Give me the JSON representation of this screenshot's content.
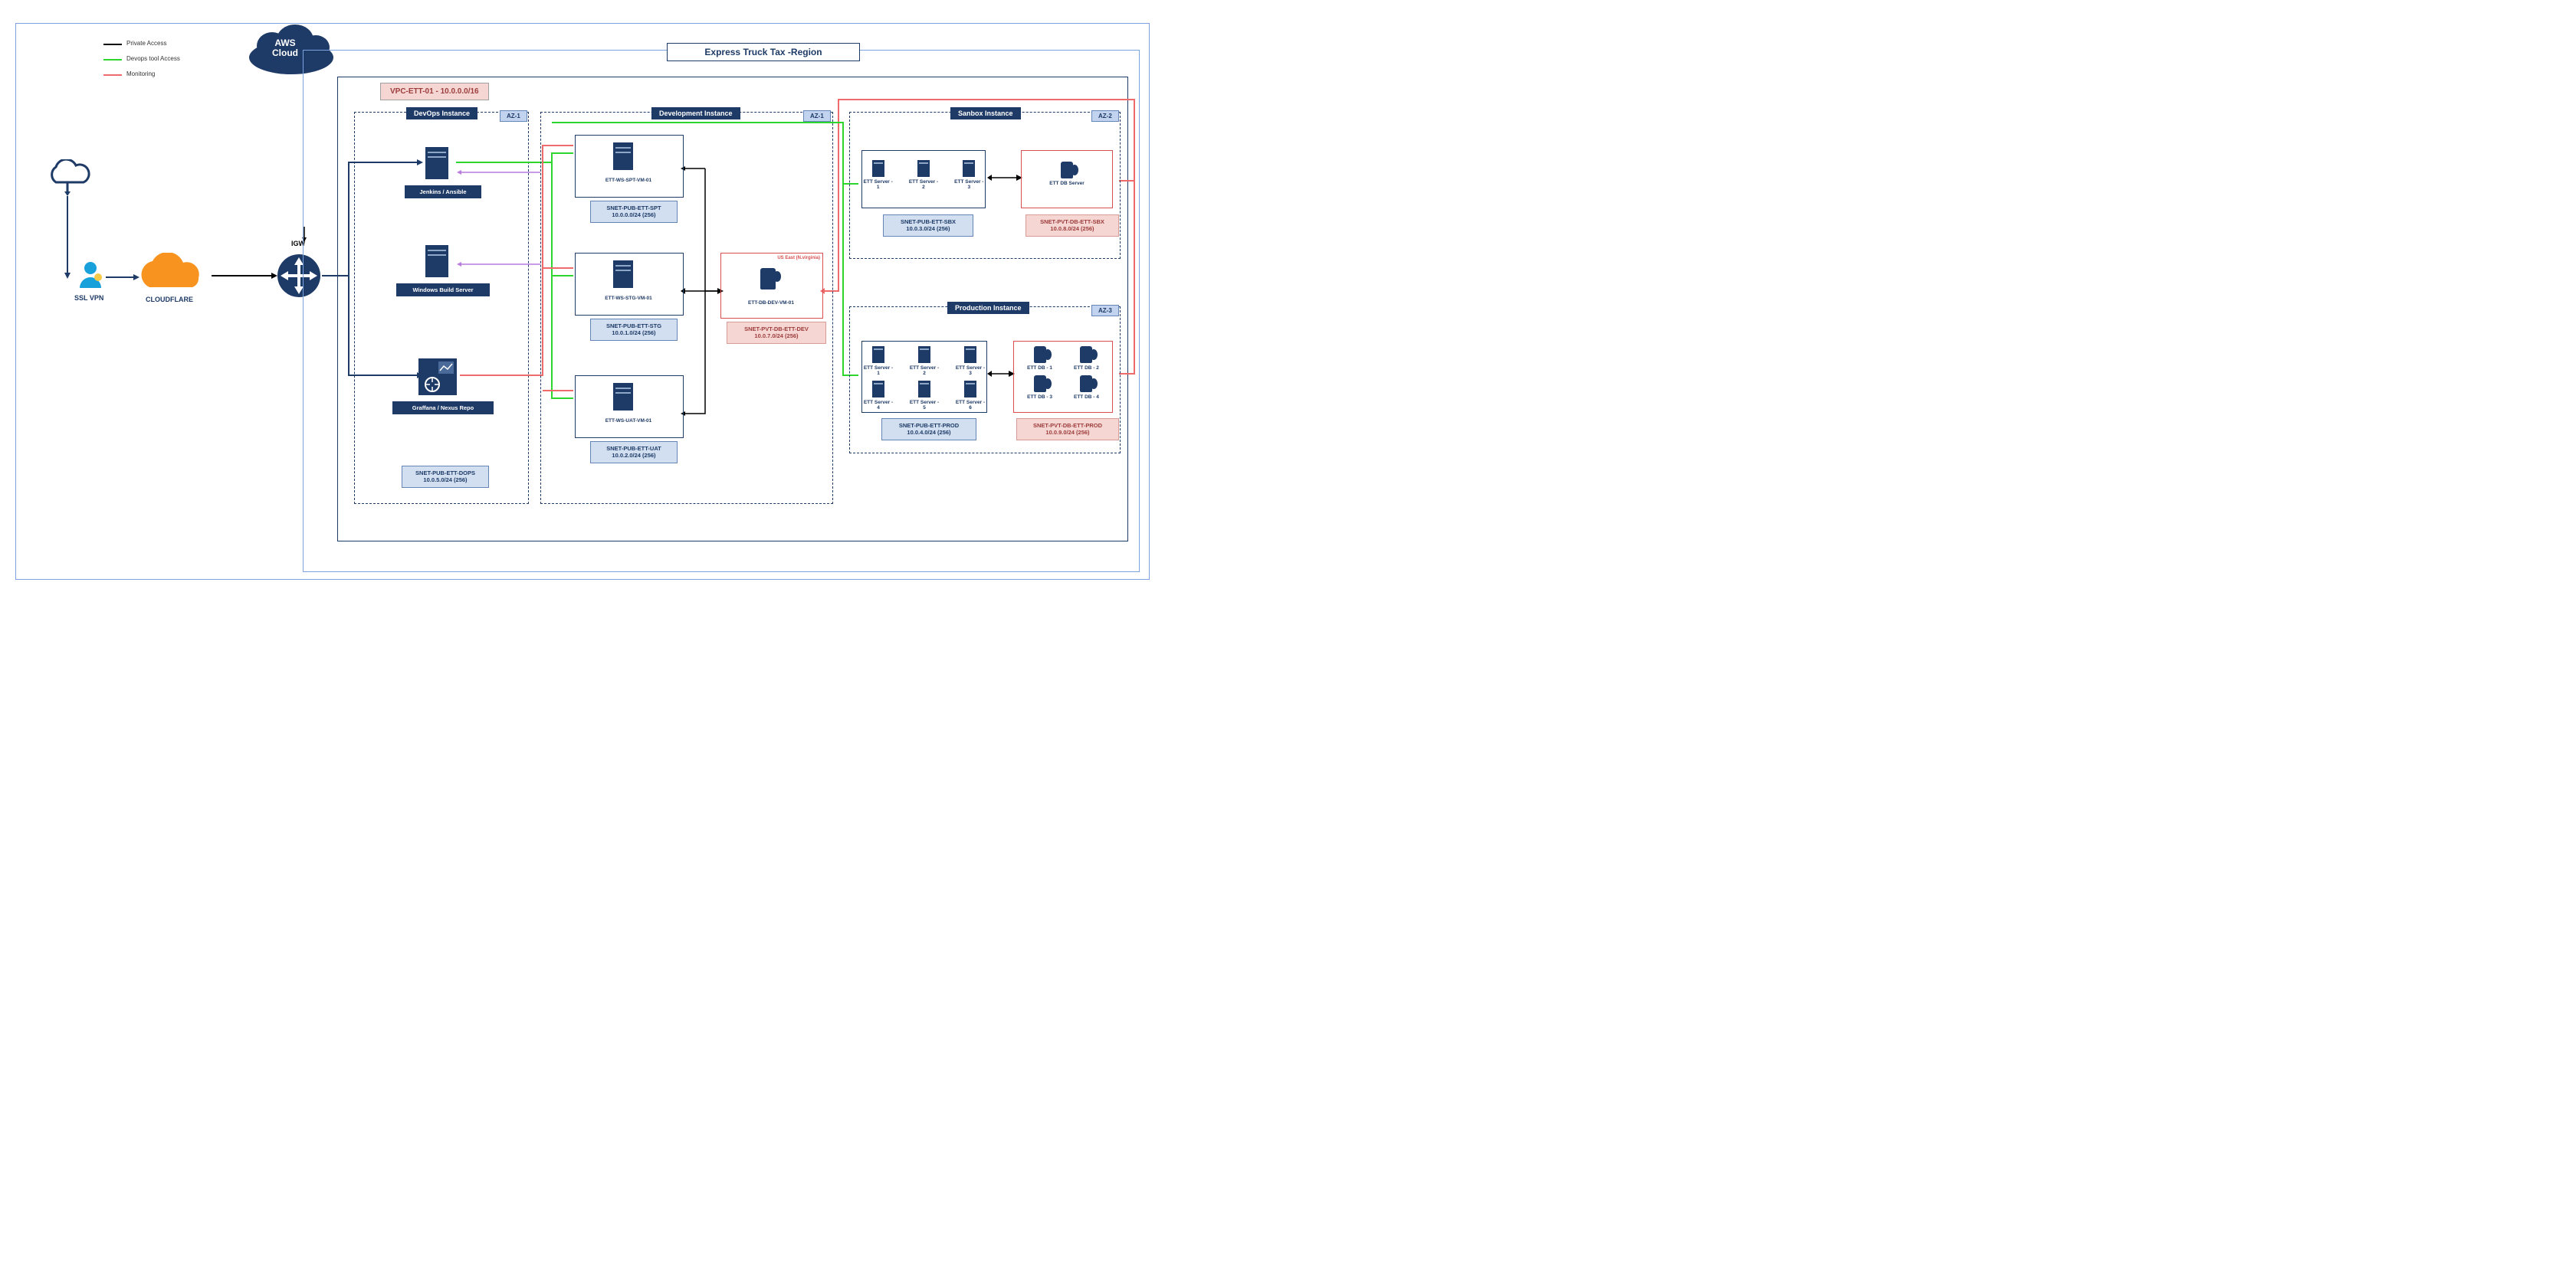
{
  "legend": {
    "private": "Private Access",
    "devops": "Devops tool Access",
    "monitoring": "Monitoring"
  },
  "cloud": {
    "aws": "AWS\nCloud",
    "igw": "IGW"
  },
  "left": {
    "vpn": "SSL VPN",
    "cloudflare": "CLOUDFLARE"
  },
  "region": {
    "title": "Express Truck Tax -Region"
  },
  "vpc": {
    "label": "VPC-ETT-01   -   10.0.0.0/16"
  },
  "az": {
    "z1": "AZ-1",
    "z2": "AZ-2",
    "z3": "AZ-3"
  },
  "groups": {
    "devops": "DevOps Instance",
    "dev": "Development Instance",
    "sbx": "Sanbox Instance",
    "prod": "Production Instance"
  },
  "devops": {
    "jenkins": "Jenkins / Ansible",
    "wbs": "Windows Build Server",
    "grafana": "Graffana / Nexus Repo",
    "subnet": "SNET-PUB-ETT-DOPS\n10.0.5.0/24 (256)"
  },
  "dev": {
    "spt_vm": "ETT-WS-SPT-VM-01",
    "spt_subnet": "SNET-PUB-ETT-SPT\n10.0.0.0/24 (256)",
    "stg_vm": "ETT-WS-STG-VM-01",
    "stg_subnet": "SNET-PUB-ETT-STG\n10.0.1.0/24 (256)",
    "uat_vm": "ETT-WS-UAT-VM-01",
    "uat_subnet": "SNET-PUB-ETT-UAT\n10.0.2.0/24 (256)",
    "db_region": "US East (N.virginia)",
    "db_vm": "ETT-DB-DEV-VM-01",
    "db_subnet": "SNET-PVT-DB-ETT-DEV\n10.0.7.0/24 (256)"
  },
  "sbx": {
    "s1": "ETT Server - 1",
    "s2": "ETT Server - 2",
    "s3": "ETT Server - 3",
    "db": "ETT DB Server",
    "pub_subnet": "SNET-PUB-ETT-SBX\n10.0.3.0/24 (256)",
    "pvt_subnet": "SNET-PVT-DB-ETT-SBX\n10.0.8.0/24 (256)"
  },
  "prod": {
    "s1": "ETT Server - 1",
    "s2": "ETT Server - 2",
    "s3": "ETT Server - 3",
    "s4": "ETT Server - 4",
    "s5": "ETT Server - 5",
    "s6": "ETT Server - 6",
    "d1": "ETT DB - 1",
    "d2": "ETT DB - 2",
    "d3": "ETT DB - 3",
    "d4": "ETT DB - 4",
    "pub_subnet": "SNET-PUB-ETT-PROD\n10.0.4.0/24 (256)",
    "pvt_subnet": "SNET-PVT-DB-ETT-PROD\n10.0.9.0/24 (256)"
  }
}
